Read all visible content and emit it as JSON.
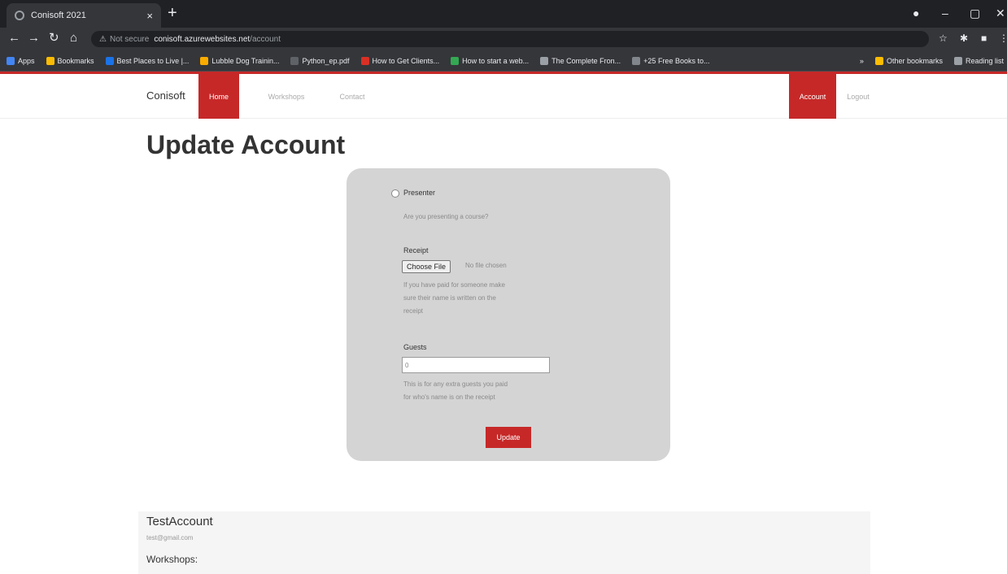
{
  "browser": {
    "tab_title": "Conisoft 2021",
    "tab_close": "×",
    "new_tab": "+",
    "window_controls": [
      "–",
      "▢",
      "✕"
    ],
    "nav": {
      "back": "←",
      "forward": "→",
      "reload": "↻",
      "home": "⌂"
    },
    "address": {
      "security_icon": "warning-icon",
      "not_secure": "Not secure",
      "host": "conisoft.azurewebsites.net",
      "path": "/account"
    },
    "bookmarks": [
      {
        "label": "Apps",
        "color": "#4285f4"
      },
      {
        "label": "Bookmarks",
        "color": "#fbbc04"
      },
      {
        "label": "Best Places to Live |...",
        "color": "#1a73e8"
      },
      {
        "label": "Lubble Dog Trainin...",
        "color": "#f9ab00"
      },
      {
        "label": "Python_ep.pdf",
        "color": "#5f6368"
      },
      {
        "label": "How to Get Clients...",
        "color": "#d93025"
      },
      {
        "label": "How to start a web...",
        "color": "#34a853"
      },
      {
        "label": "The Complete Fron...",
        "color": "#9aa0a6"
      },
      {
        "label": "+25 Free Books to...",
        "color": "#80868b"
      }
    ],
    "bookmarks_more": "»",
    "other_bookmarks": "Other bookmarks",
    "reading_list": "Reading list"
  },
  "site": {
    "brand": "Conisoft",
    "nav_home": "Home",
    "nav_workshops": "Workshops",
    "nav_contact": "Contact",
    "nav_account": "Account",
    "nav_logout": "Logout",
    "accent_color": "#c62828"
  },
  "page": {
    "title": "Update Account"
  },
  "form": {
    "presenter_label": "Presenter",
    "presenter_help": "Are you presenting a course?",
    "receipt_label": "Receipt",
    "choose_file": "Choose File",
    "no_file": "No file chosen",
    "receipt_help_1": "If you have paid for someone make",
    "receipt_help_2": "sure their name is written on the",
    "receipt_help_3": "receipt",
    "guests_label": "Guests",
    "guests_value": "0",
    "guests_help_1": "This is for any extra guests you paid",
    "guests_help_2": "for who's name is on the receipt",
    "update_button": "Update"
  },
  "account": {
    "name": "TestAccount",
    "email": "test@gmail.com",
    "workshops_label": "Workshops:"
  }
}
